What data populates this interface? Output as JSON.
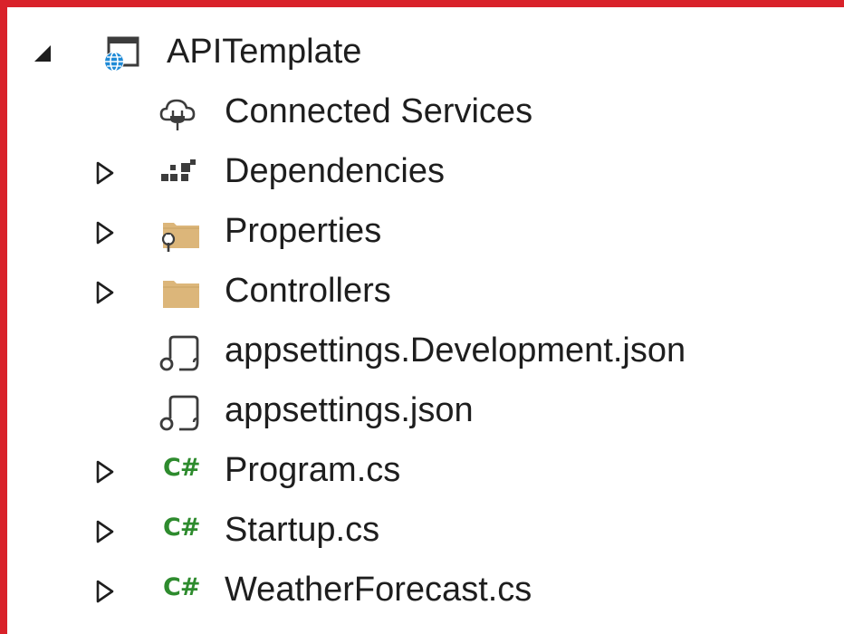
{
  "colors": {
    "frame_border": "#d9222a",
    "folder": "#dcb67a",
    "csharp": "#2e8b2e",
    "globe": "#1f8ad6",
    "text": "#1e1e1e"
  },
  "tree": {
    "root": {
      "label": "APITemplate",
      "icon": "web-project-icon",
      "expanded": true
    },
    "items": [
      {
        "label": "Connected Services",
        "icon": "connected-services-icon",
        "expandable": false
      },
      {
        "label": "Dependencies",
        "icon": "dependencies-icon",
        "expandable": true
      },
      {
        "label": "Properties",
        "icon": "properties-folder-icon",
        "expandable": true
      },
      {
        "label": "Controllers",
        "icon": "folder-icon",
        "expandable": true
      },
      {
        "label": "appsettings.Development.json",
        "icon": "json-file-icon",
        "expandable": false
      },
      {
        "label": "appsettings.json",
        "icon": "json-file-icon",
        "expandable": false
      },
      {
        "label": "Program.cs",
        "icon": "csharp-file-icon",
        "icon_text": "C#",
        "expandable": true
      },
      {
        "label": "Startup.cs",
        "icon": "csharp-file-icon",
        "icon_text": "C#",
        "expandable": true
      },
      {
        "label": "WeatherForecast.cs",
        "icon": "csharp-file-icon",
        "icon_text": "C#",
        "expandable": true
      }
    ]
  }
}
